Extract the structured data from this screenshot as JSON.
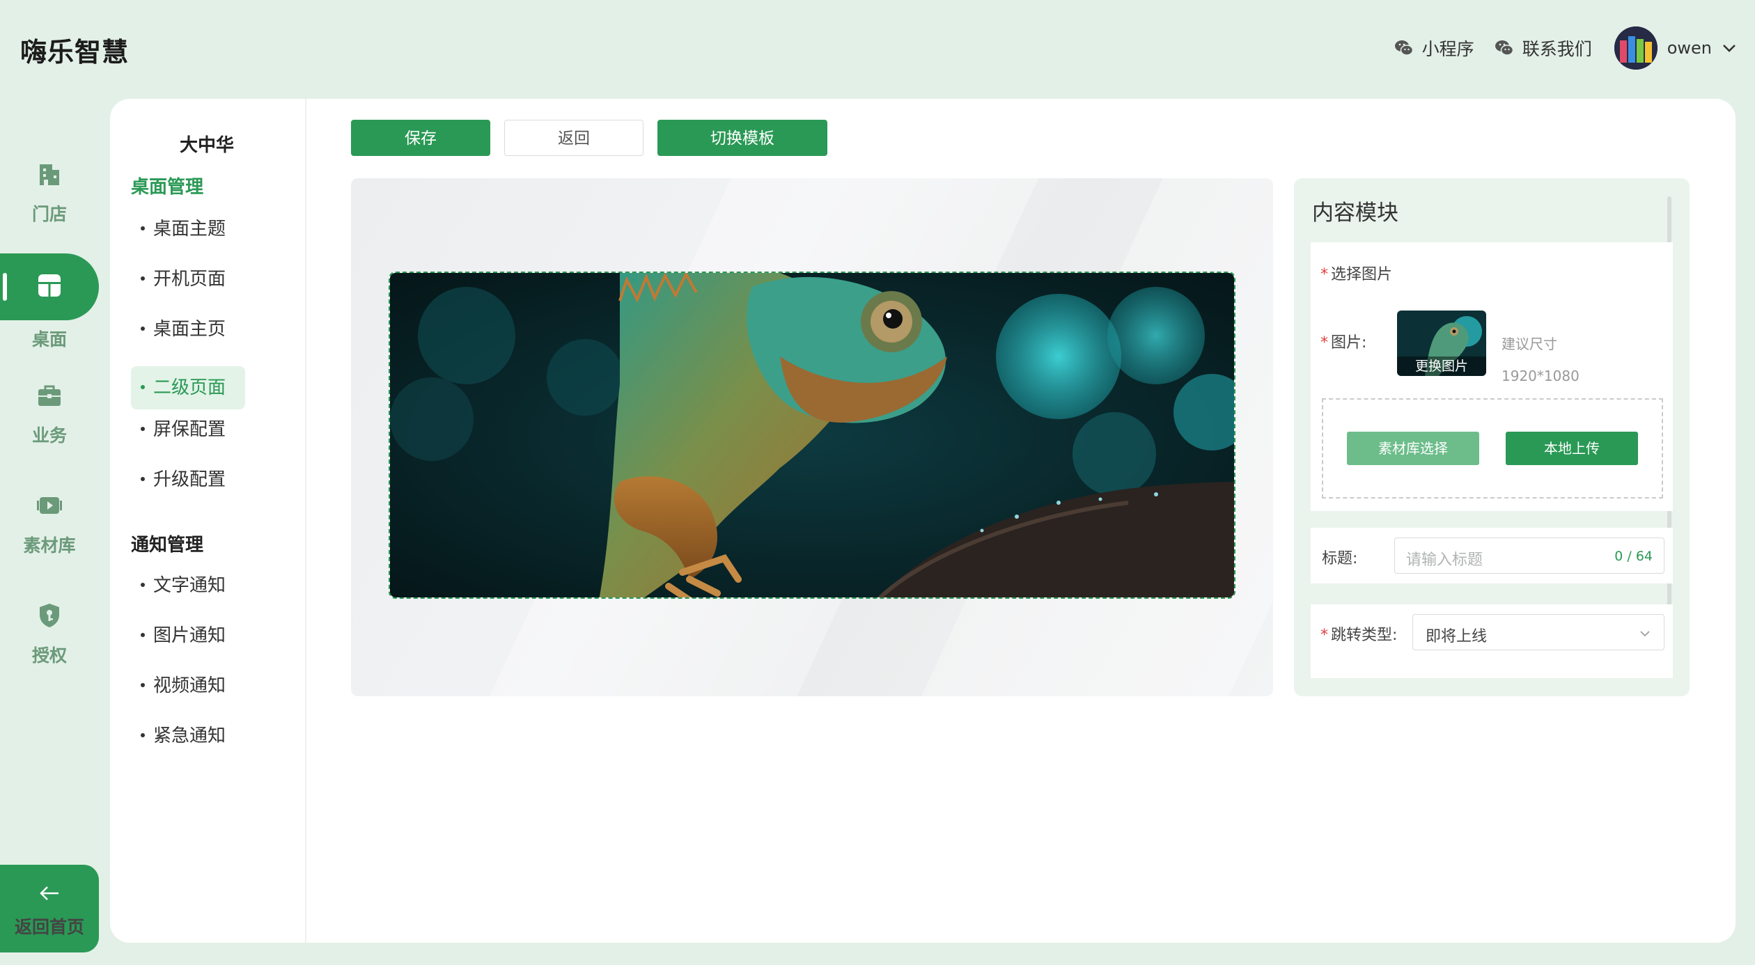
{
  "app": {
    "title": "嗨乐智慧"
  },
  "header": {
    "mini_program": "小程序",
    "contact": "联系我们",
    "user_name": "owen"
  },
  "rail": {
    "items": [
      {
        "label": "门店",
        "icon": "building-icon"
      },
      {
        "label": "桌面",
        "icon": "desktop-layout-icon"
      },
      {
        "label": "业务",
        "icon": "briefcase-icon"
      },
      {
        "label": "素材库",
        "icon": "video-library-icon"
      },
      {
        "label": "授权",
        "icon": "shield-key-icon"
      }
    ],
    "active_index": 1,
    "back_home": "返回首页"
  },
  "sub_nav": {
    "store_name": "大中华",
    "groups": [
      {
        "title": "桌面管理",
        "items": [
          "桌面主题",
          "开机页面",
          "桌面主页",
          "二级页面",
          "屏保配置",
          "升级配置"
        ]
      },
      {
        "title": "通知管理",
        "items": [
          "文字通知",
          "图片通知",
          "视频通知",
          "紧急通知"
        ]
      }
    ],
    "active_item": "二级页面"
  },
  "toolbar": {
    "save": "保存",
    "back": "返回",
    "switch_template": "切换模板"
  },
  "panel": {
    "title": "内容模块",
    "select_image": "选择图片",
    "image_label": "图片:",
    "change_image": "更换图片",
    "size_hint": "建议尺寸",
    "size_value": "1920*1080",
    "library_btn": "素材库选择",
    "upload_btn": "本地上传",
    "title_label": "标题:",
    "title_placeholder": "请输入标题",
    "title_count": "0 / 64",
    "jump_label": "跳转类型:",
    "jump_value": "即将上线"
  },
  "colors": {
    "brand_green": "#2a9955",
    "light_green_bg": "#e3f0e7",
    "library_btn": "#6cbd8a"
  }
}
